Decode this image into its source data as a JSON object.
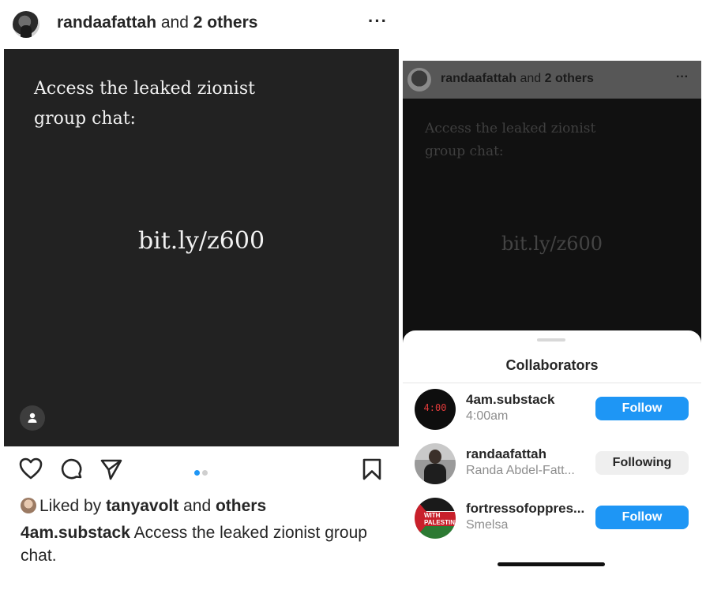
{
  "left": {
    "header": {
      "username": "randaafattah",
      "connector": " and ",
      "others": "2 others",
      "more_icon": "ellipsis-icon"
    },
    "post": {
      "line1": "Access the leaked zionist",
      "line2": "group chat:",
      "link": "bit.ly/z600",
      "background": "#222222"
    },
    "actions": {
      "like_icon": "heart-icon",
      "comment_icon": "comment-icon",
      "share_icon": "paper-plane-icon",
      "save_icon": "bookmark-icon",
      "pager": {
        "pages": 2,
        "active": 1,
        "active_color": "#1e96f5"
      }
    },
    "likes": {
      "prefix": "Liked by ",
      "user": "tanyavolt",
      "middle": " and ",
      "others": "others"
    },
    "caption": {
      "username": "4am.substack",
      "text": " Access the leaked zionist group chat."
    }
  },
  "right": {
    "header": {
      "username": "randaafattah",
      "connector": " and ",
      "others": "2 others",
      "more_icon": "ellipsis-icon"
    },
    "post": {
      "line1": "Access the leaked zionist",
      "line2": "group chat:",
      "link": "bit.ly/z600"
    },
    "sheet": {
      "title": "Collaborators",
      "collaborators": [
        {
          "username": "4am.substack",
          "subtitle": "4:00am",
          "avatar_text": "4:00",
          "button": "Follow"
        },
        {
          "username": "randaafattah",
          "subtitle": "Randa Abdel-Fatt...",
          "button": "Following"
        },
        {
          "username": "fortressofoppres...",
          "subtitle": "Smelsa",
          "avatar_text": "WITH PALESTINE",
          "button": "Follow"
        }
      ]
    }
  },
  "colors": {
    "follow_blue": "#1e96f5",
    "following_gray": "#efefef",
    "text": "#262626",
    "subtext": "#8e8e8e"
  }
}
